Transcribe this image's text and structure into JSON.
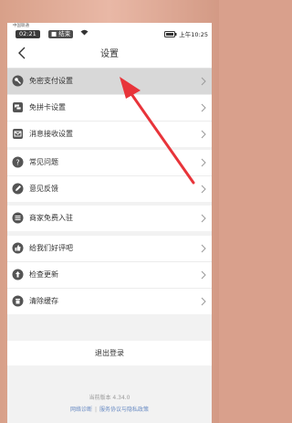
{
  "status": {
    "carrier": "中国联通",
    "time": "02:21",
    "end_call": "结束",
    "right": "上午10:25"
  },
  "nav": {
    "title": "设置"
  },
  "groups": [
    {
      "items": [
        {
          "label": "免密支付设置",
          "icon": "key-icon"
        },
        {
          "label": "免拼卡设置",
          "icon": "card-icon"
        },
        {
          "label": "消息接收设置",
          "icon": "message-icon"
        }
      ]
    },
    {
      "items": [
        {
          "label": "常见问题",
          "icon": "question-icon"
        },
        {
          "label": "意见反馈",
          "icon": "edit-icon"
        }
      ]
    },
    {
      "items": [
        {
          "label": "商家免费入驻",
          "icon": "list-icon"
        }
      ]
    },
    {
      "items": [
        {
          "label": "给我们好评吧",
          "icon": "thumbs-up-icon"
        },
        {
          "label": "检查更新",
          "icon": "upload-icon"
        },
        {
          "label": "清除缓存",
          "icon": "trash-icon"
        }
      ]
    }
  ],
  "logout": "退出登录",
  "version": "当前版本 4.34.0",
  "links": {
    "diagnose": "网络诊断",
    "sep": "|",
    "agreement": "服务协议与隐私政策"
  },
  "colors": {
    "accent": "#e8343a",
    "highlight": "#d8d8d8"
  }
}
